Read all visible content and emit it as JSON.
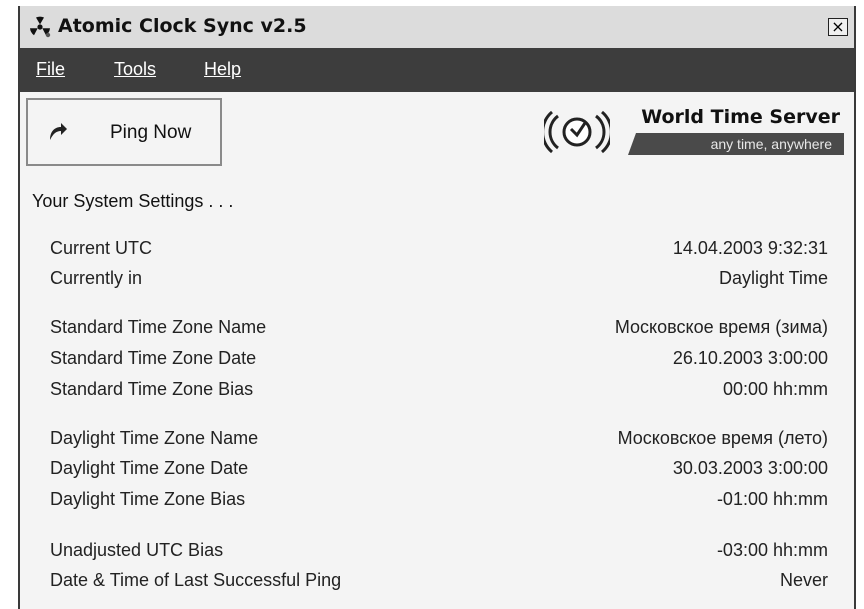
{
  "window": {
    "title": "Atomic Clock Sync v2.5",
    "close_symbol": "×",
    "app_icon": "radiation-atom-icon"
  },
  "menu": {
    "file": "File",
    "tools": "Tools",
    "help": "Help"
  },
  "toolbar": {
    "ping_label": "Ping Now",
    "ping_icon": "curved-arrow-icon",
    "logo_title": "World Time Server",
    "logo_tagline": "any time, anywhere",
    "logo_icon": "satellite-clock-icon"
  },
  "settings": {
    "heading": "Your System Settings . . .",
    "rows": [
      {
        "label": "Current UTC",
        "value": "14.04.2003 9:32:31"
      },
      {
        "label": "Currently in",
        "value": "Daylight Time"
      },
      {
        "label": "Standard Time Zone Name",
        "value": "Московское время (зима)"
      },
      {
        "label": "Standard Time Zone Date",
        "value": "26.10.2003 3:00:00"
      },
      {
        "label": "Standard Time Zone Bias",
        "value": "00:00 hh:mm"
      },
      {
        "label": "Daylight Time Zone Name",
        "value": "Московское время (лето)"
      },
      {
        "label": "Daylight Time Zone Date",
        "value": "30.03.2003 3:00:00"
      },
      {
        "label": "Daylight Time Zone Bias",
        "value": "-01:00 hh:mm"
      },
      {
        "label": "Unadjusted UTC Bias",
        "value": "-03:00 hh:mm"
      },
      {
        "label": "Date & Time of Last Successful Ping",
        "value": "Never"
      }
    ]
  },
  "colors": {
    "menubar": "#3d3d3d",
    "window_bg": "#f4f4f4",
    "logo_band": "#4a4a4a"
  }
}
